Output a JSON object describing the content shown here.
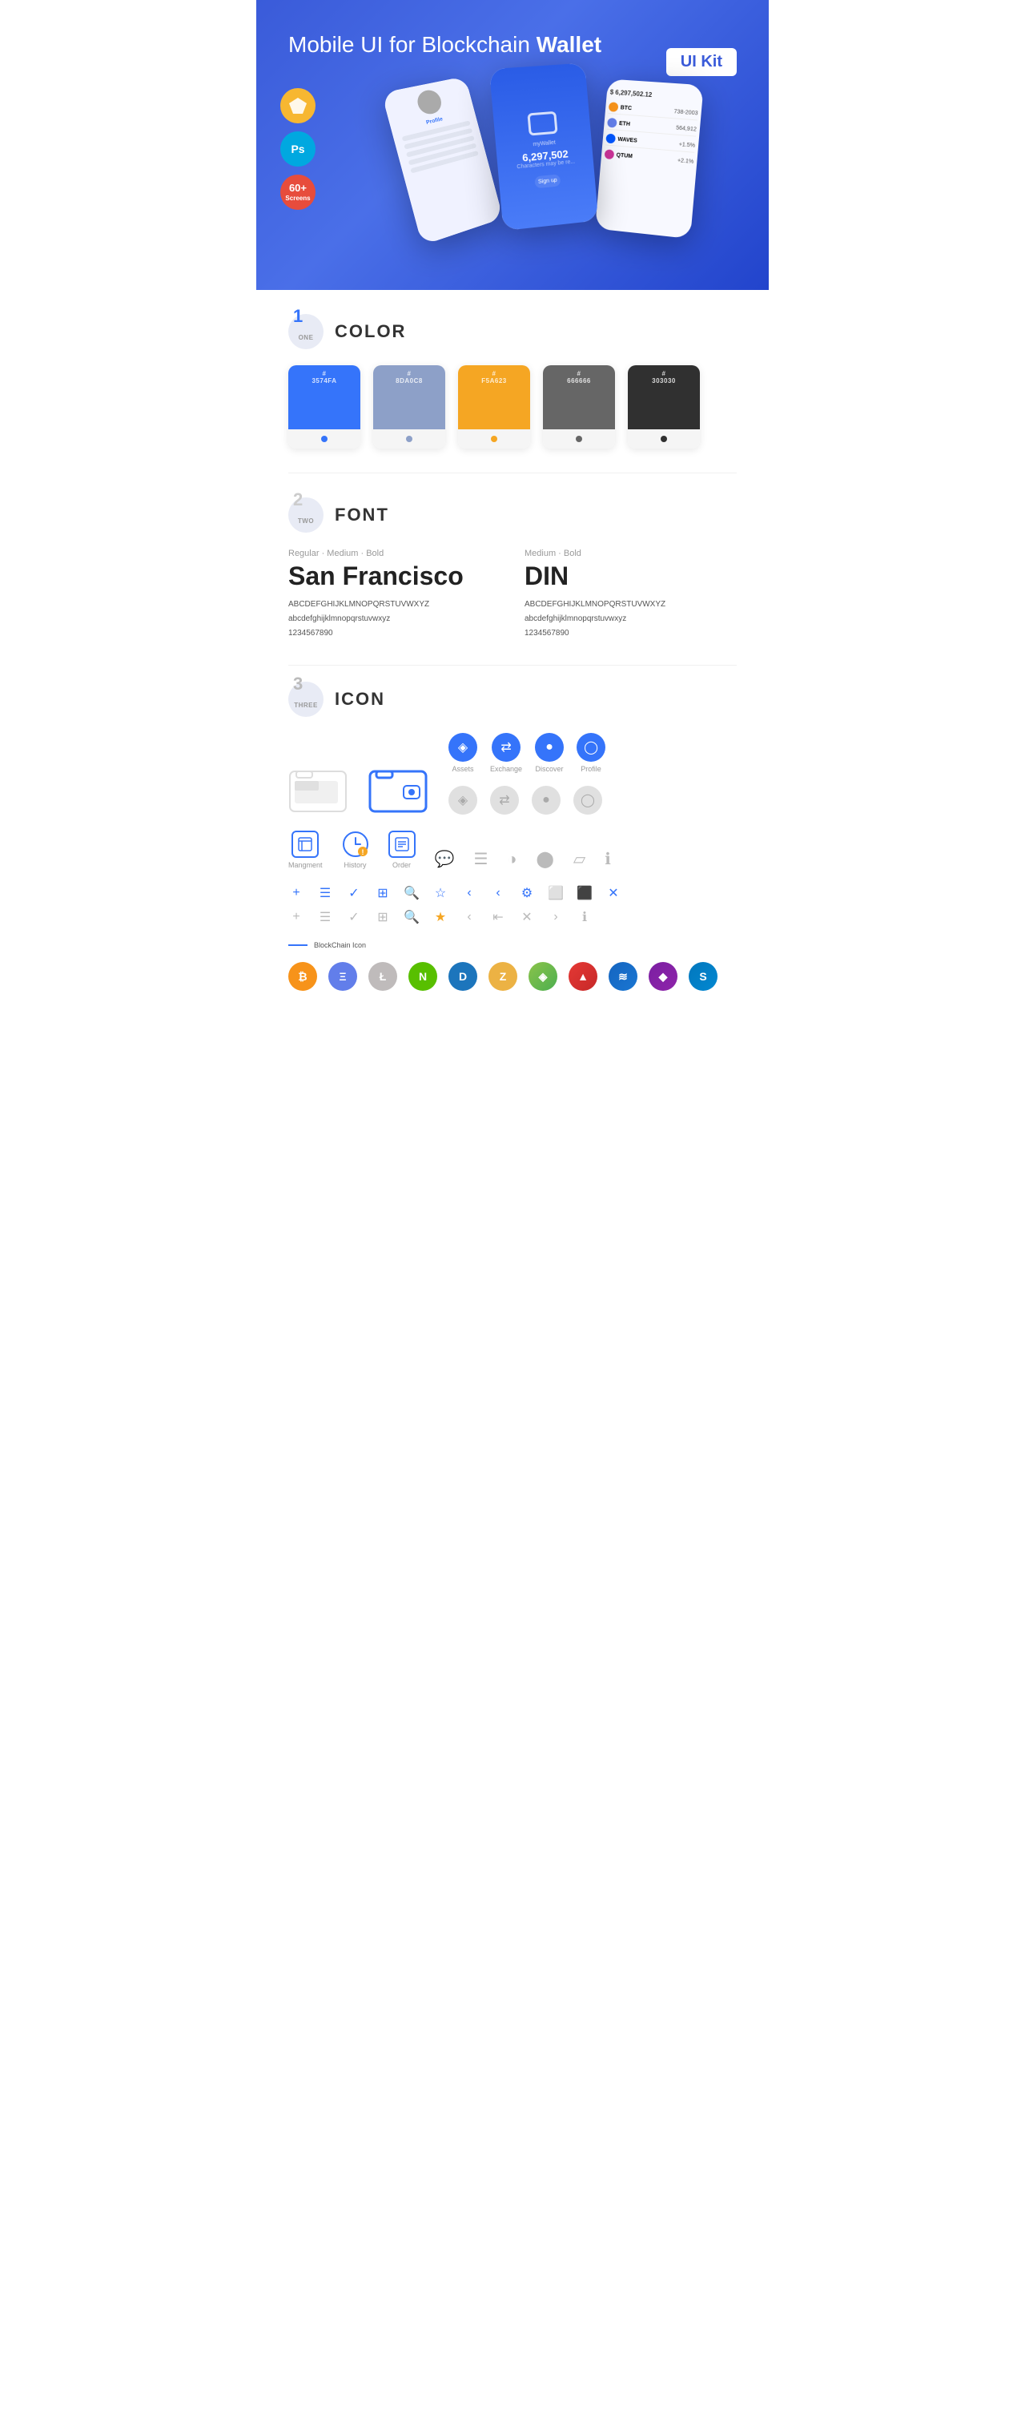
{
  "hero": {
    "title": "Mobile UI for Blockchain ",
    "title_bold": "Wallet",
    "badge": "UI Kit",
    "sketch_label": "Sketch",
    "ps_label": "Ps",
    "screens_label": "60+\nScreens"
  },
  "sections": {
    "color": {
      "number": "1",
      "number_word": "ONE",
      "title": "COLOR",
      "swatches": [
        {
          "hex": "#3574FA",
          "label": "3574FA"
        },
        {
          "hex": "#8DA0C8",
          "label": "8DA0C8"
        },
        {
          "hex": "#F5A623",
          "label": "F5A623"
        },
        {
          "hex": "#666666",
          "label": "666666"
        },
        {
          "hex": "#303030",
          "label": "303030"
        }
      ]
    },
    "font": {
      "number": "2",
      "number_word": "TWO",
      "title": "FONT",
      "font1": {
        "weights": "Regular · Medium · Bold",
        "name": "San Francisco",
        "uppercase": "ABCDEFGHIJKLMNOPQRSTUVWXYZ",
        "lowercase": "abcdefghijklmnopqrstuvwxyz",
        "numbers": "1234567890"
      },
      "font2": {
        "weights": "Medium · Bold",
        "name": "DIN",
        "uppercase": "ABCDEFGHIJKLMNOPQRSTUVWXYZ",
        "lowercase": "abcdefghijklmnopqrstuvwxyz",
        "numbers": "1234567890"
      }
    },
    "icon": {
      "number": "3",
      "number_word": "THREE",
      "title": "ICON",
      "nav_icons": [
        {
          "label": "Assets"
        },
        {
          "label": "Exchange"
        },
        {
          "label": "Discover"
        },
        {
          "label": "Profile"
        }
      ],
      "bottom_nav": [
        {
          "label": "Mangment"
        },
        {
          "label": "History"
        },
        {
          "label": "Order"
        }
      ],
      "blockchain_label": "BlockChain Icon",
      "cryptos": [
        {
          "symbol": "₿",
          "name": "Bitcoin",
          "class": "ci-btc"
        },
        {
          "symbol": "Ξ",
          "name": "Ethereum",
          "class": "ci-eth"
        },
        {
          "symbol": "Ł",
          "name": "Litecoin",
          "class": "ci-ltc"
        },
        {
          "symbol": "N",
          "name": "NEO",
          "class": "ci-neo"
        },
        {
          "symbol": "D",
          "name": "Dash",
          "class": "ci-dash"
        },
        {
          "symbol": "Z",
          "name": "ZCash",
          "class": "ci-zcash"
        },
        {
          "symbol": "◈",
          "name": "IOTA",
          "class": "ci-iota"
        },
        {
          "symbol": "▲",
          "name": "Ark",
          "class": "ci-ark"
        },
        {
          "symbol": "≋",
          "name": "Waves",
          "class": "ci-waves"
        },
        {
          "symbol": "◆",
          "name": "Matic",
          "class": "ci-matic"
        },
        {
          "symbol": "S",
          "name": "Stratis",
          "class": "ci-stratis"
        }
      ]
    }
  }
}
